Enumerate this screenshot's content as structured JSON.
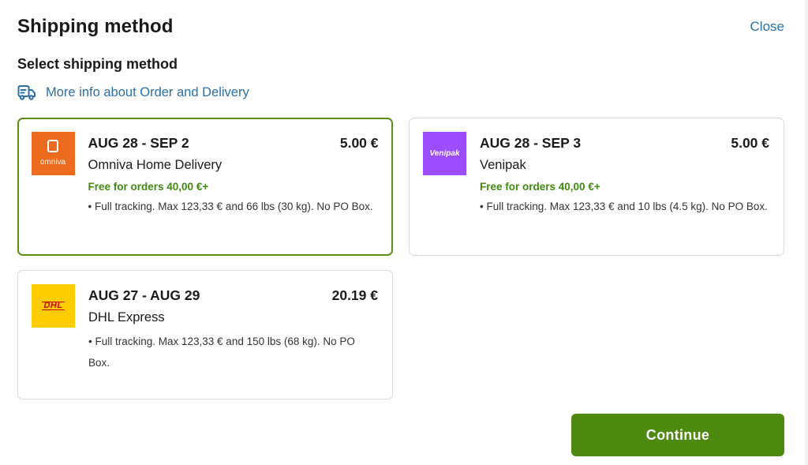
{
  "header": {
    "title": "Shipping method",
    "close_label": "Close"
  },
  "subtitle": "Select shipping method",
  "info_link": {
    "label": "More info about Order and Delivery",
    "icon": "delivery-truck-icon"
  },
  "options": [
    {
      "logo_text": "omniva",
      "dates": "AUG 28 - SEP 2",
      "price": "5.00 €",
      "carrier": "Omniva Home Delivery",
      "free_note": "Free for orders 40,00 €+",
      "detail": "• Full tracking. Max 123,33 € and 66 lbs (30 kg). No PO Box.",
      "selected": true,
      "brand_color": "#ec6b1f"
    },
    {
      "logo_text": "Venipak",
      "dates": "AUG 28 - SEP 3",
      "price": "5.00 €",
      "carrier": "Venipak",
      "free_note": "Free for orders 40,00 €+",
      "detail": "• Full tracking. Max 123,33 € and 10 lbs (4.5 kg). No PO Box.",
      "selected": false,
      "brand_color": "#9b4dff"
    },
    {
      "logo_text": "DHL",
      "dates": "AUG 27 - AUG 29",
      "price": "20.19 €",
      "carrier": "DHL Express",
      "detail": "• Full tracking. Max 123,33 € and 150 lbs (68 kg). No PO Box.",
      "selected": false,
      "brand_color": "#ffcc00"
    }
  ],
  "continue_label": "Continue",
  "colors": {
    "accent_green": "#4f8a10",
    "link_blue": "#2a6fa8",
    "selected_border": "#5a8f12"
  }
}
